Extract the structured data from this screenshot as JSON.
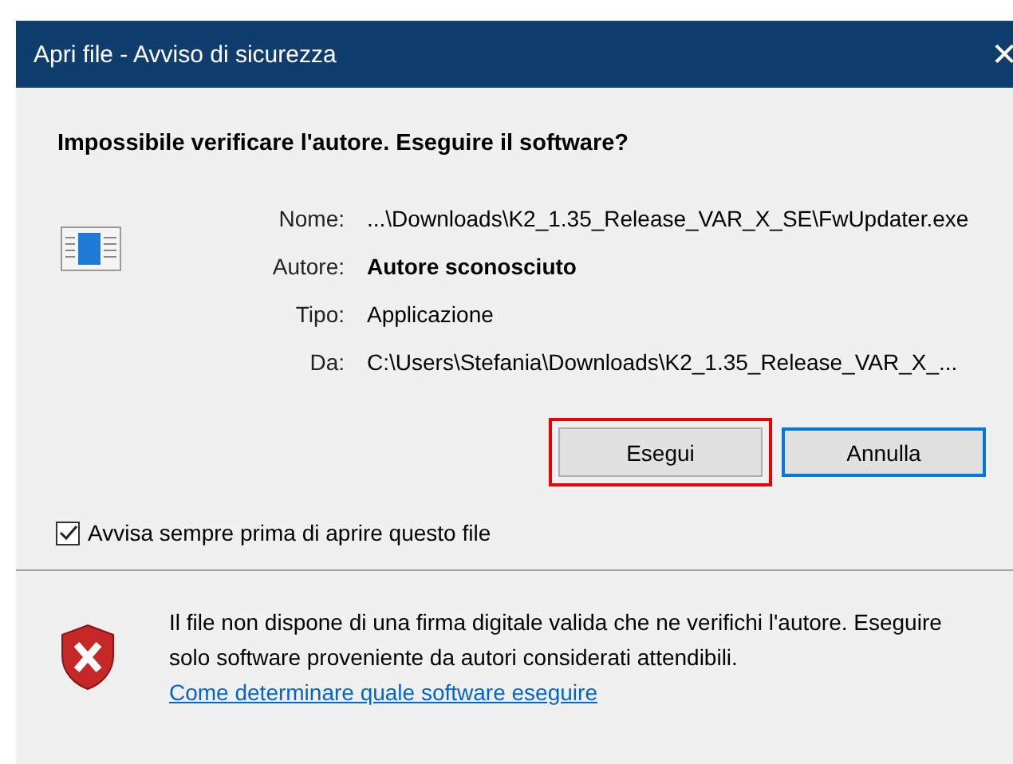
{
  "window": {
    "title": "Apri file - Avviso di sicurezza",
    "close": "✕"
  },
  "heading": "Impossibile verificare l'autore. Eseguire il software?",
  "details": [
    {
      "label": "Nome:",
      "value": "...\\Downloads\\K2_1.35_Release_VAR_X_SE\\FwUpdater.exe",
      "bold": false
    },
    {
      "label": "Autore:",
      "value": "Autore sconosciuto",
      "bold": true
    },
    {
      "label": "Tipo:",
      "value": "Applicazione",
      "bold": false
    },
    {
      "label": "Da:",
      "value": "C:\\Users\\Stefania\\Downloads\\K2_1.35_Release_VAR_X_...",
      "bold": false
    }
  ],
  "buttons": [
    {
      "label": "Esegui",
      "default": false,
      "highlighted": true
    },
    {
      "label": "Annulla",
      "default": true,
      "highlighted": false
    }
  ],
  "checkbox": {
    "label": "Avvisa sempre prima di aprire questo file",
    "checked": true
  },
  "warning": {
    "text": "Il file non dispone di una firma digitale valida che ne verifichi l'autore. Eseguire solo software proveniente da autori considerati attendibili.",
    "link": "Come determinare quale software eseguire"
  }
}
